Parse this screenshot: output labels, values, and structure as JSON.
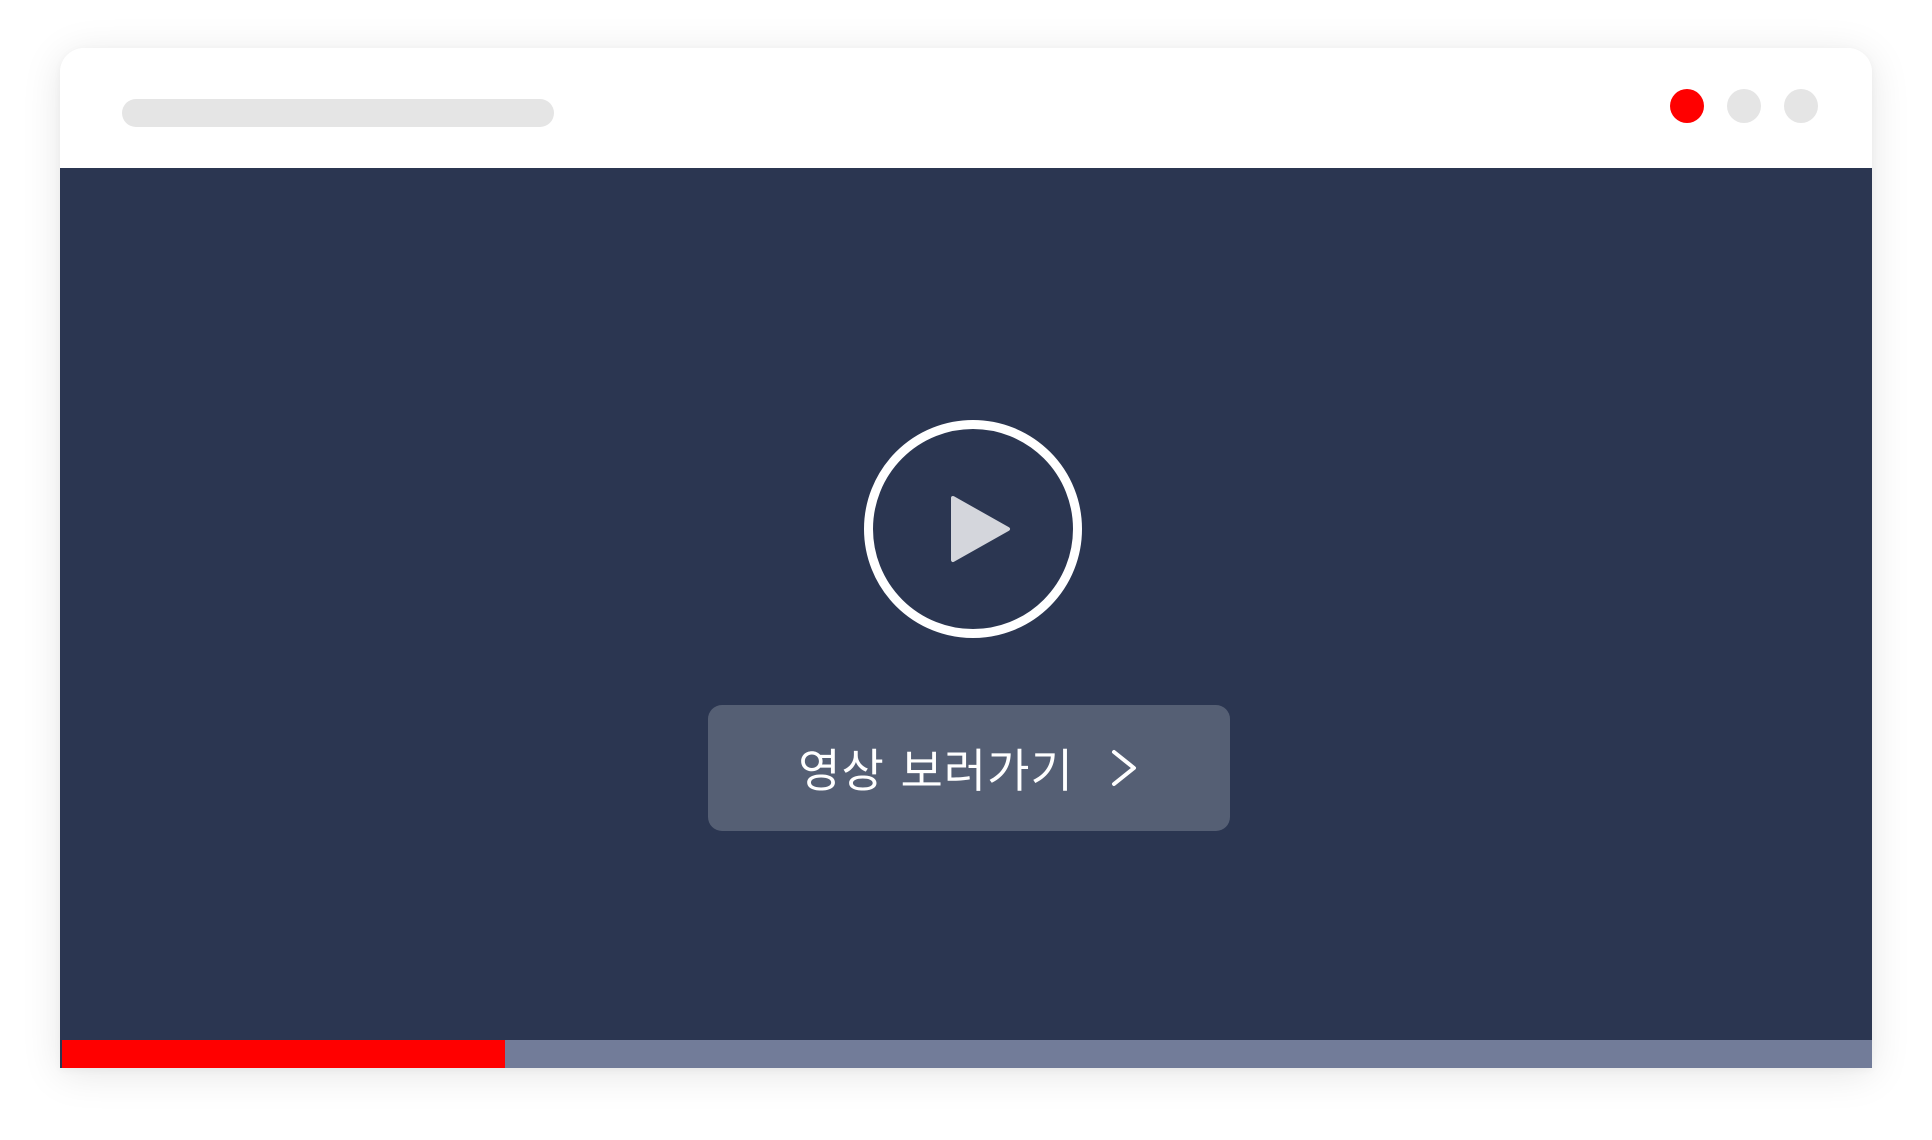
{
  "window": {
    "controls": [
      {
        "name": "close",
        "color": "#ff0000"
      },
      {
        "name": "minimize",
        "color": "#e5e5e5"
      },
      {
        "name": "maximize",
        "color": "#e5e5e5"
      }
    ]
  },
  "player": {
    "background_color": "#2b3651",
    "play_icon": "play-icon",
    "cta": {
      "label": "영상 보러가기",
      "icon": "chevron-right-icon",
      "background_color": "#555f74"
    },
    "progress": {
      "fraction": 0.245,
      "fill_color": "#ff0000",
      "track_color": "#727c99"
    }
  }
}
